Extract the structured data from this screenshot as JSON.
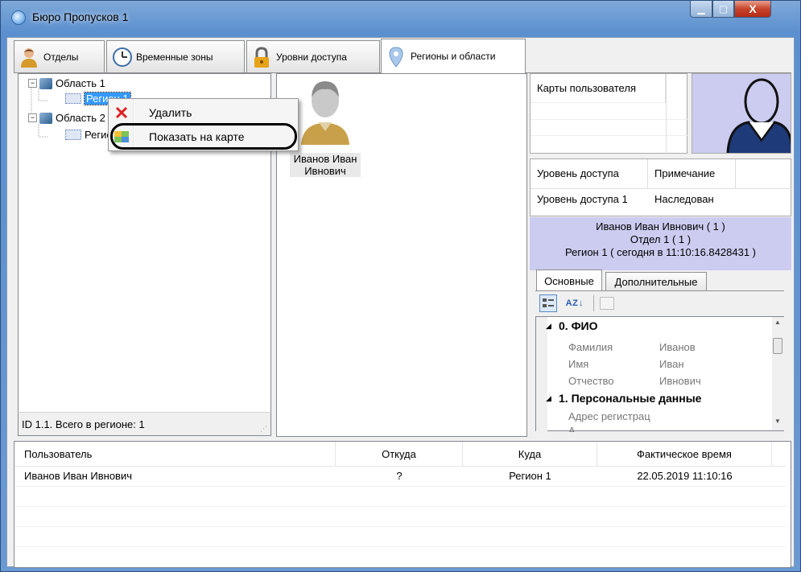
{
  "window": {
    "title": "Бюро Пропусков 1",
    "min_glyph": "▁",
    "max_glyph": "▢",
    "close_glyph": "X"
  },
  "tabs": [
    {
      "label": "Отделы",
      "icon": "person-icon"
    },
    {
      "label": "Временные зоны",
      "icon": "clock-icon"
    },
    {
      "label": "Уровни доступа",
      "icon": "padlock-icon"
    },
    {
      "label": "Регионы и области",
      "icon": "map-pin-icon",
      "active": true
    }
  ],
  "tree": {
    "nodes": [
      {
        "label": "Область 1",
        "expander": "−"
      },
      {
        "label": "Регион 1",
        "selected": true
      },
      {
        "label": "Область 2",
        "expander": "−"
      },
      {
        "label": "Регион 2"
      }
    ],
    "status": "ID 1.1. Всего в регионе: 1"
  },
  "context_menu": {
    "items": [
      {
        "label": "Удалить",
        "icon": "delete-x-icon"
      },
      {
        "label": "Показать на карте",
        "icon": "map-icon"
      }
    ]
  },
  "center": {
    "person_line1": "Иванов Иван",
    "person_line2": "Ивнович"
  },
  "cards": {
    "header": "Карты пользователя"
  },
  "access": {
    "headers": [
      "Уровень доступа",
      "Примечание"
    ],
    "row": [
      "Уровень доступа 1",
      "Наследован"
    ]
  },
  "info": {
    "line1": "Иванов Иван Ивнович ( 1 )",
    "line2": "Отдел 1 ( 1 )",
    "line3": "Регион 1 ( сегодня в 11:10:16.8428431 )"
  },
  "props": {
    "tabs": [
      "Основные",
      "Дополнительные"
    ],
    "sort_glyph": "A Z ↓",
    "cat1": "0. ФИО",
    "rows": [
      {
        "name": "Фамилия",
        "value": "Иванов"
      },
      {
        "name": "Имя",
        "value": "Иван"
      },
      {
        "name": "Отчество",
        "value": "Ивнович"
      }
    ],
    "cat2": "1. Персональные данные",
    "row_addr": "Адрес регистрац",
    "row_next": "А"
  },
  "events": {
    "headers": [
      "Пользователь",
      "Откуда",
      "Куда",
      "Фактическое время"
    ],
    "rows": [
      [
        "Иванов Иван Ивнович",
        "?",
        "Регион 1",
        "22.05.2019 11:10:16"
      ]
    ]
  },
  "colors": {
    "selection": "#3399ff",
    "info_bg": "#ccccf0",
    "titlebar": "#6b99d2"
  }
}
